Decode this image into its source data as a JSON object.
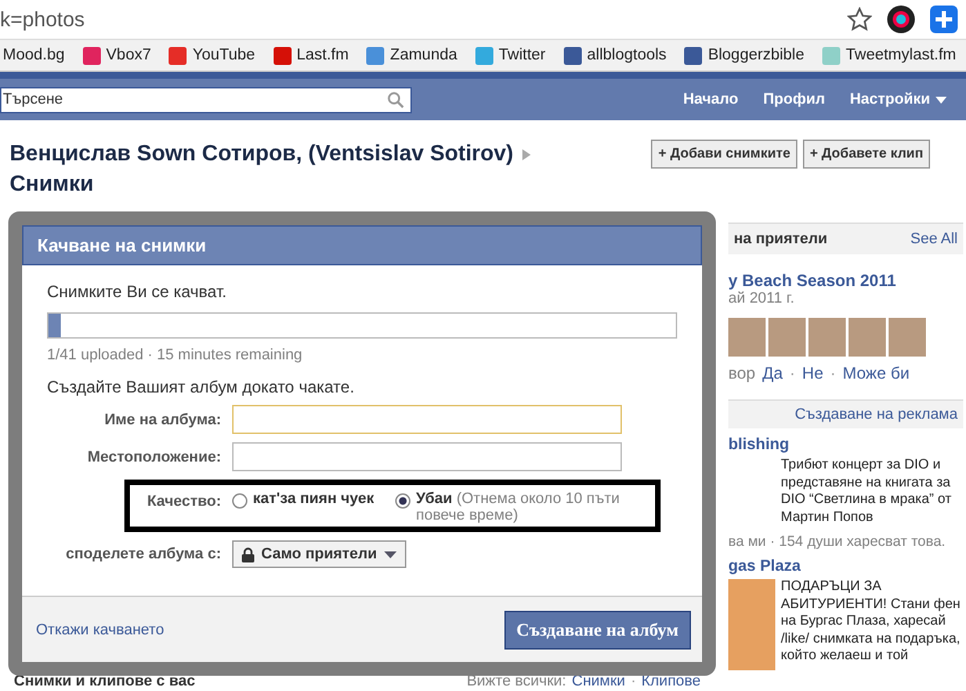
{
  "browser": {
    "address": "k=photos",
    "bookmarks": [
      {
        "label": "Mood.bg"
      },
      {
        "label": "Vbox7",
        "color": "#e0245e"
      },
      {
        "label": "YouTube",
        "color": "#e52d27"
      },
      {
        "label": "Last.fm",
        "color": "#d51007"
      },
      {
        "label": "Zamunda",
        "color": "#4a90d9"
      },
      {
        "label": "Twitter",
        "color": "#33aadd"
      },
      {
        "label": "allblogtools",
        "color": "#3b5998"
      },
      {
        "label": "Bloggerzbible",
        "color": "#3b5998"
      },
      {
        "label": "Tweetmylast.fm",
        "color": "#8fd0c8"
      }
    ]
  },
  "header": {
    "search_placeholder": "Търсене",
    "nav": [
      {
        "label": "Начало",
        "caret": false
      },
      {
        "label": "Профил",
        "caret": false
      },
      {
        "label": "Настройки",
        "caret": true
      }
    ]
  },
  "page": {
    "title": "Венцислав Sown Сотиров, (Ventsislav Sotirov)",
    "subtitle": "Снимки",
    "buttons": [
      "+ Добави снимките",
      "+ Добавете клип"
    ],
    "bottom": {
      "title": "Снимки и клипове с вас",
      "see_all": "Вижте всички:",
      "separator": "·",
      "links": [
        "Снимки",
        "Клипове"
      ]
    }
  },
  "sidebar": {
    "section_title": "на приятели",
    "see_all": "See All",
    "event_title": "y Beach Season 2011",
    "event_date": "ай 2011 г.",
    "rsvp_prefix": "вор",
    "separator": "·",
    "rsvp": [
      "Да",
      "Не",
      "Може би"
    ],
    "ads_header": "Създаване на реклама",
    "ads": [
      {
        "title": "blishing",
        "text": "Трибют концерт за DIO и представяне на книгата за DIO “Светлина в мрака” от Мартин Попов",
        "image": false,
        "likes": "ва ми · 154 души харесват това."
      },
      {
        "title": "gas Plaza",
        "text": "ПОДАРЪЦИ ЗА АБИТУРИЕНТИ! Стани фен на Бургас Плаза, харесай /like/ снимката на подаръка, който желаеш и той",
        "image": true
      }
    ]
  },
  "dialog": {
    "title": "Качване на снимки",
    "status": "Снимките Ви се качват.",
    "progress": {
      "level": 0.02,
      "text": "1/41 uploaded · 15 minutes remaining"
    },
    "prompt": "Създайте Вашият албум докато чакате.",
    "fields": [
      {
        "label": "Име на албума:",
        "focused": true
      },
      {
        "label": "Местоположение:",
        "focused": false
      }
    ],
    "quality": {
      "label": "Качество:",
      "options": [
        {
          "label": "кат'за пиян чуек",
          "selected": false
        },
        {
          "label": "Убаи",
          "note": "(Отнема около 10 пъти повече време)",
          "selected": true
        }
      ]
    },
    "share": {
      "label": "споделете албума с:",
      "value": "Само приятели"
    },
    "cancel": "Откажи качването",
    "submit": "Създаване на албум"
  }
}
